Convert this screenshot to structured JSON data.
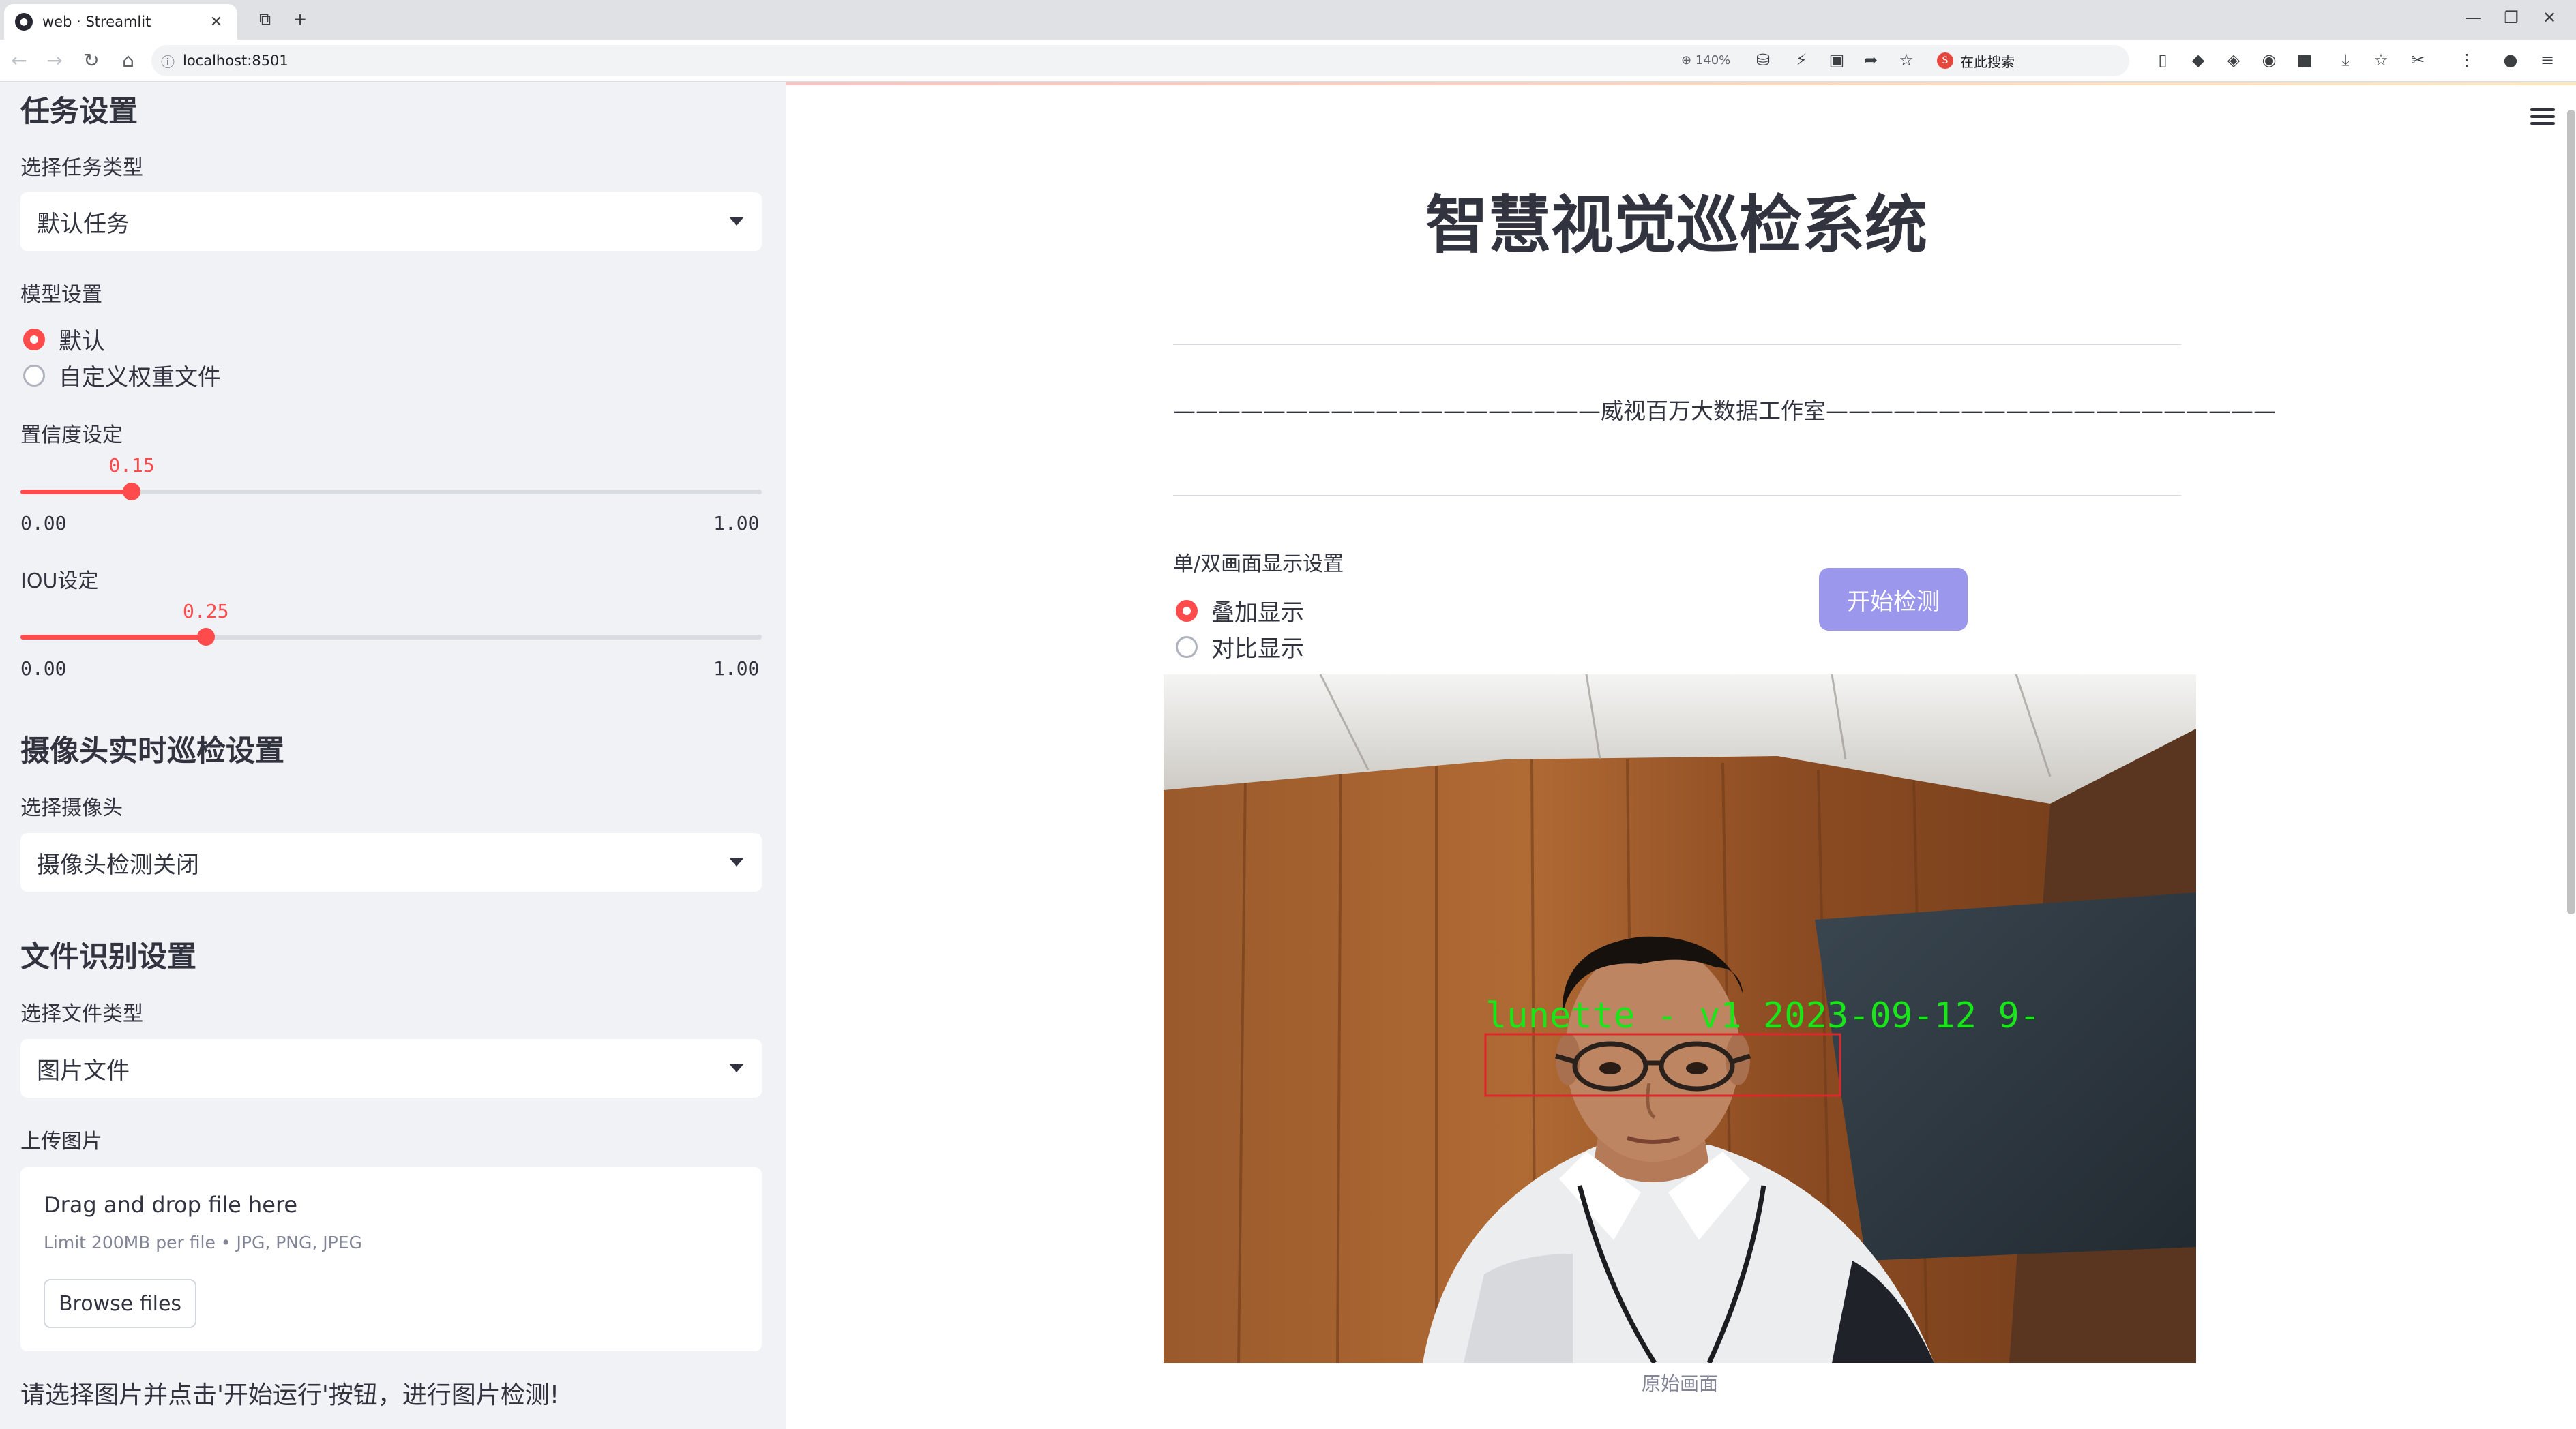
{
  "browser": {
    "tab_title": "web · Streamlit",
    "favicon_glyph": "●",
    "url": "localhost:8501",
    "zoom": "140%",
    "search_placeholder": "在此搜索",
    "search_logo": "S"
  },
  "sidebar": {
    "task_section": {
      "heading": "任务设置",
      "task_type_label": "选择任务类型",
      "task_type_value": "默认任务"
    },
    "model": {
      "label": "模型设置",
      "options": [
        "默认",
        "自定义权重文件"
      ],
      "selected": "默认"
    },
    "confidence": {
      "label": "置信度设定",
      "value": "0.15",
      "value_fraction": 0.15,
      "min": "0.00",
      "max": "1.00"
    },
    "iou": {
      "label": "IOU设定",
      "value": "0.25",
      "value_fraction": 0.25,
      "min": "0.00",
      "max": "1.00"
    },
    "camera_section": {
      "heading": "摄像头实时巡检设置",
      "label": "选择摄像头",
      "value": "摄像头检测关闭"
    },
    "file_section": {
      "heading": "文件识别设置",
      "file_type_label": "选择文件类型",
      "file_type_value": "图片文件",
      "upload_label": "上传图片",
      "drop_text": "Drag and drop file here",
      "limit_text": "Limit 200MB per file • JPG, PNG, JPEG",
      "browse_label": "Browse files"
    },
    "note": "请选择图片并点击'开始运行'按钮，进行图片检测!"
  },
  "main": {
    "title": "智慧视觉巡检系统",
    "credit": "———————————————————威视百万大数据工作室————————————————————",
    "display_label": "单/双画面显示设置",
    "display_options": [
      "叠加显示",
      "对比显示"
    ],
    "display_selected": "叠加显示",
    "start_button": "开始检测",
    "detection_label": "lunette - v1 2023-09-12 9-",
    "caption": "原始画面"
  },
  "colors": {
    "accent": "#ff4b4b",
    "sidebar_bg": "#f0f2f6",
    "start_button": "#9b97ed",
    "detection_box": "#e0262a",
    "detection_text": "#19e619"
  }
}
